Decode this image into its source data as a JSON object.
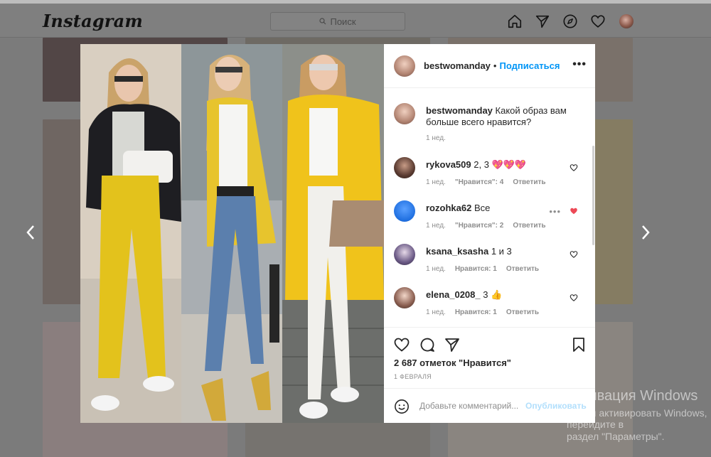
{
  "header": {
    "logo": "Instagram",
    "search_placeholder": "Поиск",
    "icons": [
      "home-icon",
      "direct-icon",
      "explore-icon",
      "activity-heart-icon",
      "profile-avatar"
    ]
  },
  "post": {
    "author": "bestwomanday",
    "separator": "•",
    "follow_label": "Подписаться",
    "caption": "Какой образ вам больше всего нравится?",
    "caption_time": "1 нед.",
    "comments": [
      {
        "user": "rykova509",
        "text": "2, 3 💖💖💖",
        "time": "1 нед.",
        "likes": "\"Нравится\": 4",
        "reply": "Ответить",
        "liked": false
      },
      {
        "user": "rozohka62",
        "text": "Все",
        "time": "1 нед.",
        "likes": "\"Нравится\": 2",
        "reply": "Ответить",
        "liked": true
      },
      {
        "user": "ksana_ksasha",
        "text": "1 и 3",
        "time": "1 нед.",
        "likes": "Нравится: 1",
        "reply": "Ответить",
        "liked": false
      },
      {
        "user": "elena_0208_",
        "text": "3 👍",
        "time": "1 нед.",
        "likes": "Нравится: 1",
        "reply": "Ответить",
        "liked": false
      }
    ],
    "likes_count": "2 687 отметок \"Нравится\"",
    "date": "1 ФЕВРАЛЯ",
    "comment_placeholder": "Добавьте комментарий...",
    "publish_label": "Опубликовать"
  },
  "windows_activation": {
    "title": "Активация Windows",
    "line1": "Чтобы активировать Windows, перейдите в",
    "line2": "раздел \"Параметры\"."
  },
  "colors": {
    "accent": "#0095f6",
    "like_red": "#ed4956",
    "dim_overlay": "#7b7b7b"
  }
}
